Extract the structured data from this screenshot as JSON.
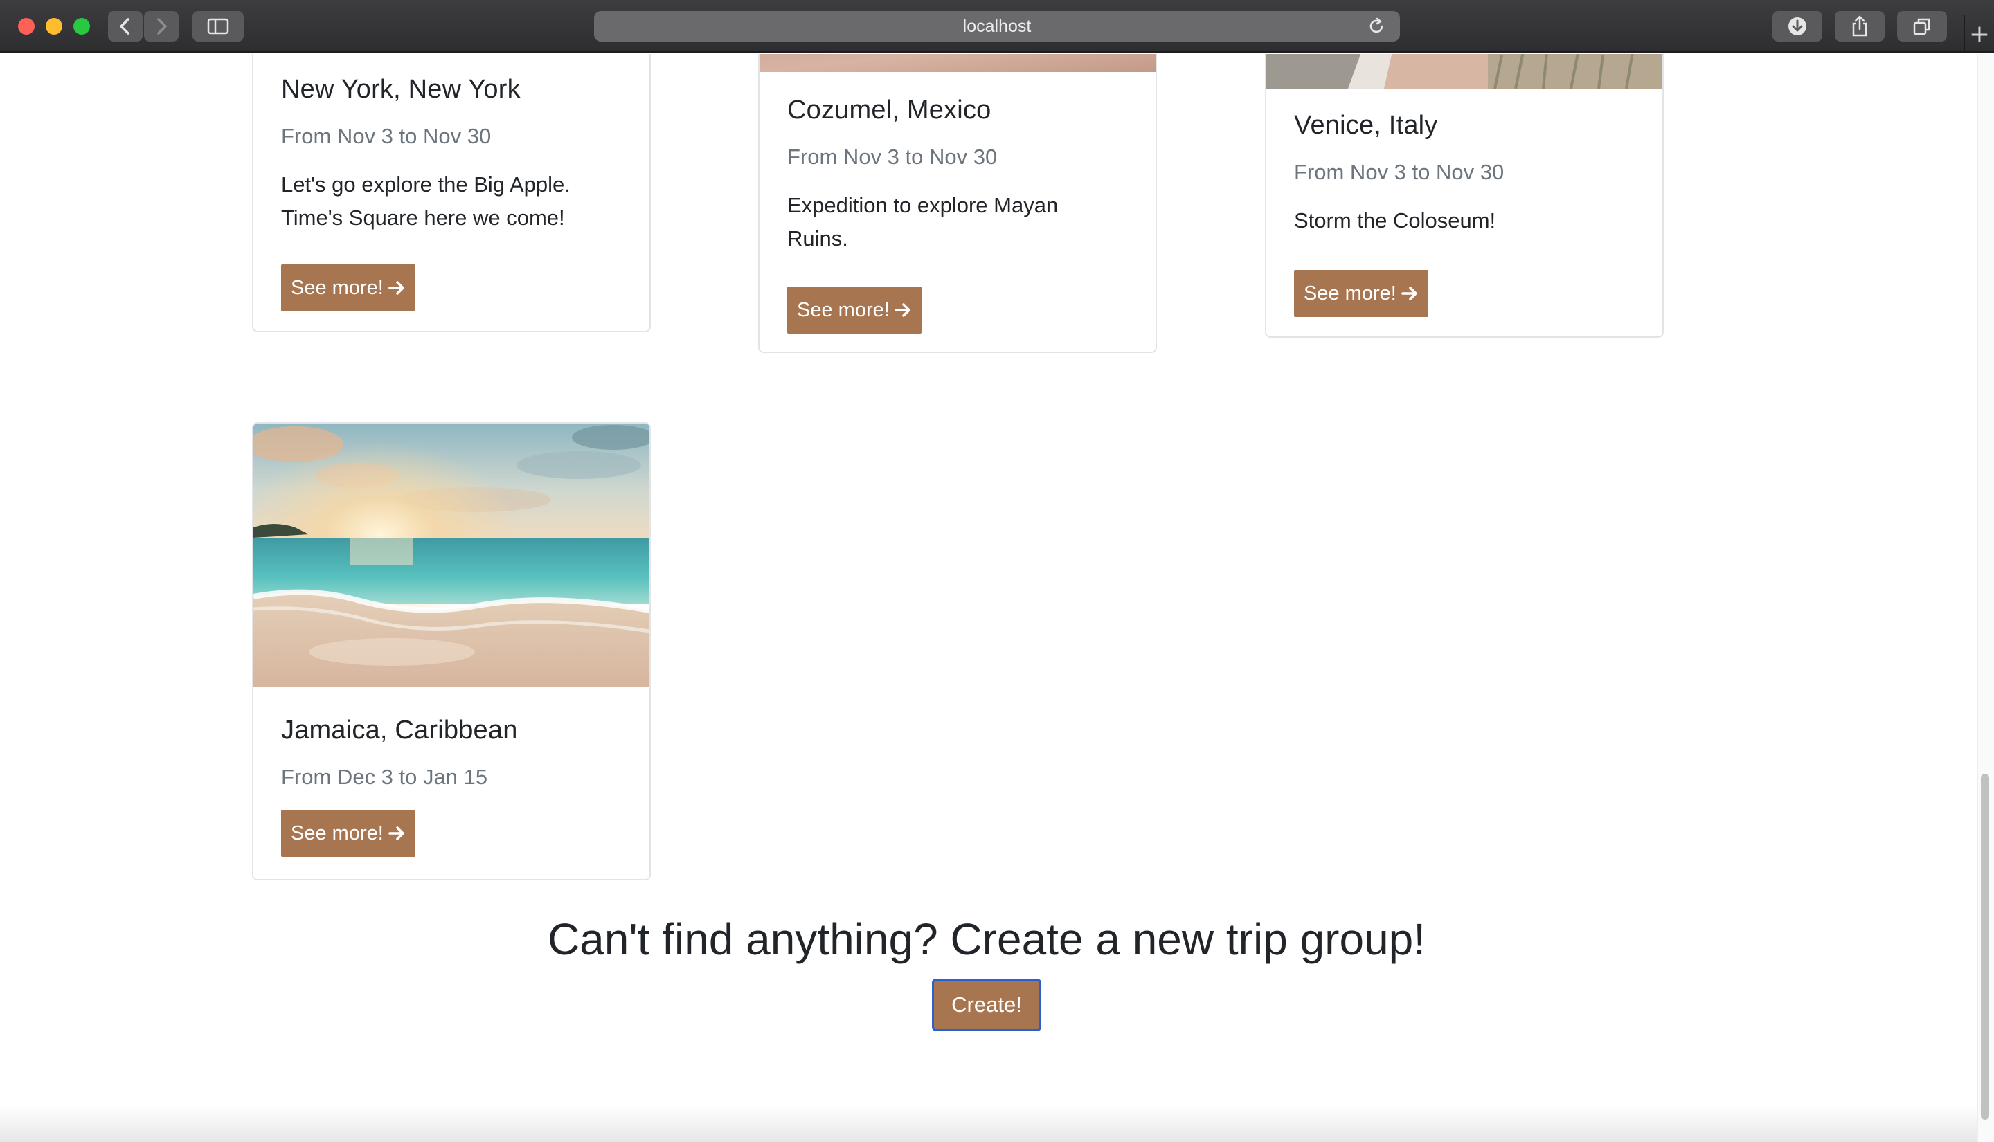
{
  "browser": {
    "url": "localhost",
    "icons": {
      "back": "chevron-left-icon",
      "forward": "chevron-right-icon",
      "sidebar": "sidebar-icon",
      "reload": "reload-icon",
      "download": "download-icon",
      "share": "share-icon",
      "tabs": "tabs-overview-icon",
      "new_tab": "plus-icon"
    }
  },
  "trips": [
    {
      "title": "New York, New York",
      "dates": "From Nov 3 to Nov 30",
      "description": "Let's go explore the Big Apple. Time's Square here we come!",
      "button": "See more!"
    },
    {
      "title": "Cozumel, Mexico",
      "dates": "From Nov 3 to Nov 30",
      "description": "Expedition to explore Mayan Ruins.",
      "button": "See more!"
    },
    {
      "title": "Venice, Italy",
      "dates": "From Nov 3 to Nov 30",
      "description": "Storm the Coloseum!",
      "button": "See more!"
    },
    {
      "title": "Jamaica, Caribbean",
      "dates": "From Dec 3 to Jan 15",
      "description": "",
      "button": "See more!"
    }
  ],
  "cta": {
    "heading": "Can't find anything? Create a new trip group!",
    "button": "Create!"
  },
  "colors": {
    "accent": "#a77651",
    "focus_ring": "#2c5ed1",
    "muted_text": "#6c757d"
  }
}
